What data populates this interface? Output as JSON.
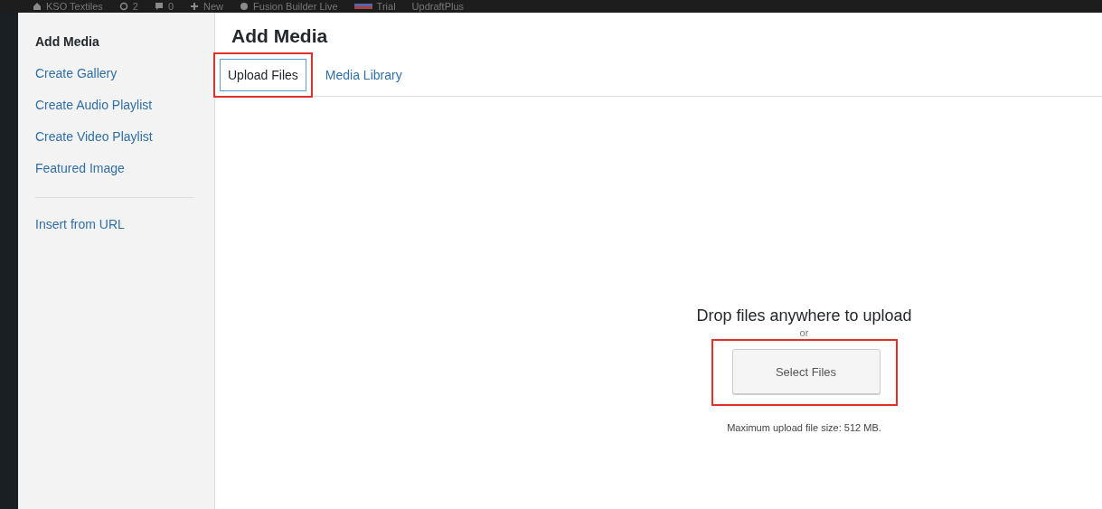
{
  "admin_bar": {
    "items": [
      {
        "kind": "site",
        "label": "KSO Textiles"
      },
      {
        "kind": "updates",
        "label": "2"
      },
      {
        "kind": "comments",
        "label": "0"
      },
      {
        "kind": "new",
        "label": "New"
      },
      {
        "kind": "builder",
        "label": "Fusion Builder Live"
      },
      {
        "kind": "flag",
        "label": "Trial"
      },
      {
        "kind": "text",
        "label": "UpdraftPlus"
      }
    ]
  },
  "sidebar": {
    "items": [
      {
        "label": "Add Media",
        "selected": true
      },
      {
        "label": "Create Gallery",
        "selected": false
      },
      {
        "label": "Create Audio Playlist",
        "selected": false
      },
      {
        "label": "Create Video Playlist",
        "selected": false
      },
      {
        "label": "Featured Image",
        "selected": false
      }
    ],
    "extra_items": [
      {
        "label": "Insert from URL",
        "selected": false
      }
    ]
  },
  "title": "Add Media",
  "tabs": [
    {
      "label": "Upload Files",
      "selected": true,
      "highlighted": true
    },
    {
      "label": "Media Library",
      "selected": false,
      "highlighted": false
    }
  ],
  "uploader": {
    "instructions": "Drop files anywhere to upload",
    "separator": "or",
    "button": {
      "label": "Select Files",
      "highlighted": true
    },
    "max_size": "Maximum upload file size: 512 MB."
  }
}
